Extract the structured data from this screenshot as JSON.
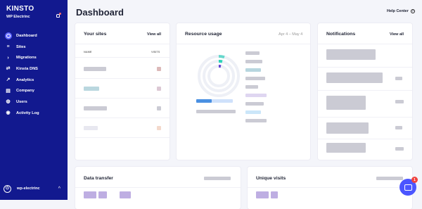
{
  "sidebar": {
    "brand": "KINSTO",
    "site_name": "WP Electrinc",
    "items": [
      {
        "label": "Dashboard",
        "icon": "dashboard-icon"
      },
      {
        "label": "Sites",
        "icon": "sites-icon"
      },
      {
        "label": "Migrations",
        "icon": "migrations-icon"
      },
      {
        "label": "Kinsta DNS",
        "icon": "dns-icon"
      },
      {
        "label": "Analytics",
        "icon": "analytics-icon"
      },
      {
        "label": "Company",
        "icon": "company-icon"
      },
      {
        "label": "Users",
        "icon": "users-icon"
      },
      {
        "label": "Activity Log",
        "icon": "activity-log-icon"
      }
    ],
    "user_label": "wp-electrinc",
    "user_initial": "⏻",
    "collapse_glyph": "^"
  },
  "header": {
    "title": "Dashboard",
    "help_label": "Help Center"
  },
  "sites_card": {
    "title": "Your sites",
    "view_all": "View all",
    "col_name": "NAME",
    "col_visits": "VISITS"
  },
  "resource_card": {
    "title": "Resource usage",
    "range": "Apr 4 – May 4"
  },
  "notifications_card": {
    "title": "Notifications",
    "view_all": "View all"
  },
  "transfer_card": {
    "title": "Data transfer"
  },
  "visits_card": {
    "title": "Unique visits"
  },
  "chat": {
    "badge": "1"
  },
  "colors": {
    "sidebar": "#12198f",
    "accent": "#5f67ff",
    "chat": "#4b55ff",
    "teal": "#2ad4b8"
  }
}
